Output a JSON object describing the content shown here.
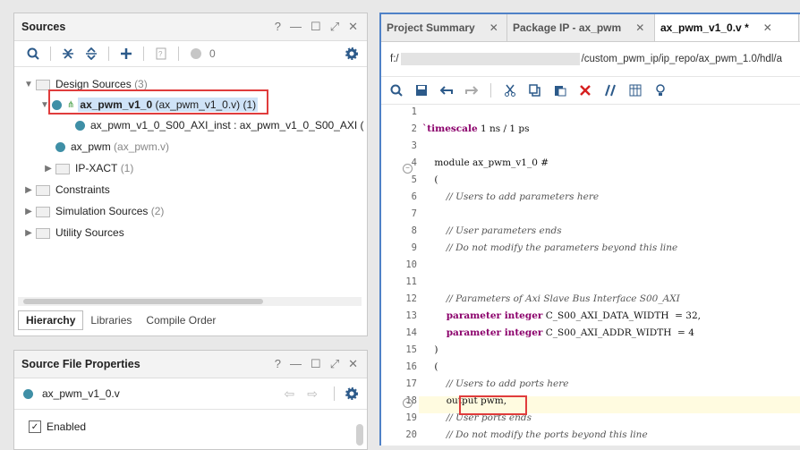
{
  "sources": {
    "title": "Sources",
    "header_buttons": [
      "?",
      "—",
      "☐",
      "⤢",
      "✕"
    ],
    "toolbar_count": "0",
    "tree": {
      "design_sources": {
        "label": "Design Sources",
        "count": "(3)"
      },
      "top": {
        "name": "ax_pwm_v1_0",
        "file": "(ax_pwm_v1_0.v) (1)"
      },
      "inst": {
        "label": "ax_pwm_v1_0_S00_AXI_inst : ax_pwm_v1_0_S00_AXI ("
      },
      "ax_pwm": {
        "name": "ax_pwm",
        "file": "(ax_pwm.v)"
      },
      "ipxact": {
        "label": "IP-XACT",
        "count": "(1)"
      },
      "constraints": {
        "label": "Constraints"
      },
      "sim": {
        "label": "Simulation Sources",
        "count": "(2)"
      },
      "utility": {
        "label": "Utility Sources"
      }
    },
    "bottom_tabs": [
      "Hierarchy",
      "Libraries",
      "Compile Order"
    ]
  },
  "props": {
    "title": "Source File Properties",
    "file": "ax_pwm_v1_0.v",
    "enabled_label": "Enabled"
  },
  "editor": {
    "tabs": [
      {
        "label": "Project Summary"
      },
      {
        "label": "Package IP - ax_pwm"
      },
      {
        "label": "ax_pwm_v1_0.v *"
      }
    ],
    "path_prefix": "f:/",
    "path_suffix": "/custom_pwm_ip/ip_repo/ax_pwm_1.0/hdl/a",
    "lines": [
      {
        "n": "1",
        "t": ""
      },
      {
        "n": "2",
        "t": "`timescale 1 ns / 1 ps"
      },
      {
        "n": "3",
        "t": ""
      },
      {
        "n": "4",
        "t": "    module ax_pwm_v1_0 #"
      },
      {
        "n": "5",
        "t": "    ("
      },
      {
        "n": "6",
        "t": "        // Users to add parameters here"
      },
      {
        "n": "7",
        "t": ""
      },
      {
        "n": "8",
        "t": "        // User parameters ends"
      },
      {
        "n": "9",
        "t": "        // Do not modify the parameters beyond this line"
      },
      {
        "n": "10",
        "t": ""
      },
      {
        "n": "11",
        "t": ""
      },
      {
        "n": "12",
        "t": "        // Parameters of Axi Slave Bus Interface S00_AXI"
      },
      {
        "n": "13",
        "t": "        parameter integer C_S00_AXI_DATA_WIDTH  = 32,"
      },
      {
        "n": "14",
        "t": "        parameter integer C_S00_AXI_ADDR_WIDTH  = 4"
      },
      {
        "n": "15",
        "t": "    )"
      },
      {
        "n": "16",
        "t": "    ("
      },
      {
        "n": "17",
        "t": "        // Users to add ports here"
      },
      {
        "n": "18",
        "t": "        output pwm,"
      },
      {
        "n": "19",
        "t": "        // User ports ends"
      },
      {
        "n": "20",
        "t": "        // Do not modify the ports beyond this line"
      }
    ]
  },
  "colors": {
    "accent": "#4f81c7",
    "highlight": "#e03c3c",
    "keyword": "#8b006b"
  }
}
